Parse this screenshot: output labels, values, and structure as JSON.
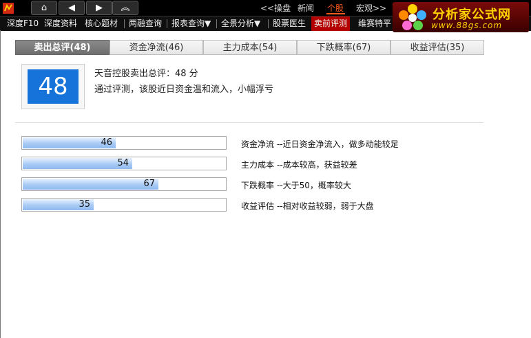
{
  "toolbar": {
    "nav_buttons": [
      {
        "name": "home-icon",
        "glyph": "⌂"
      },
      {
        "name": "back-icon",
        "glyph": "◀"
      },
      {
        "name": "forward-icon",
        "glyph": "▶"
      },
      {
        "name": "collapse-up-icon",
        "glyph": "︽"
      }
    ],
    "main_tabs": [
      "<<操盘",
      "新闻",
      "个股",
      "宏观>>"
    ],
    "active_main_tab": "个股"
  },
  "subnav": {
    "items": [
      "深度F10",
      "深度资料",
      "核心题材",
      "两融查询",
      "报表查询▼",
      "全景分析▼",
      "股票医生",
      "卖前评测",
      "维赛特平"
    ],
    "active": "卖前评测"
  },
  "watermark": {
    "name": "分析家公式网",
    "url": "www.88gs.com"
  },
  "tabs": [
    {
      "label": "卖出总评(48)",
      "active": true
    },
    {
      "label": "资金净流(46)",
      "active": false
    },
    {
      "label": "主力成本(54)",
      "active": false
    },
    {
      "label": "下跌概率(67)",
      "active": false
    },
    {
      "label": "收益评估(35)",
      "active": false
    }
  ],
  "summary": {
    "score": "48",
    "title": "天音控股卖出总评：48 分",
    "desc": "通过评测，该股近日资金温和流入，小幅浮亏"
  },
  "metrics": [
    {
      "label": "资金净流",
      "value": 46,
      "value_text": "46",
      "desc": "--近日资金净流入，做多动能较足"
    },
    {
      "label": "主力成本",
      "value": 54,
      "value_text": "54",
      "desc": "--成本较高，获益较差"
    },
    {
      "label": "下跌概率",
      "value": 67,
      "value_text": "67",
      "desc": "--大于50，概率较大"
    },
    {
      "label": "收益评估",
      "value": 35,
      "value_text": "35",
      "desc": "--相对收益较弱，弱于大盘"
    }
  ],
  "colors": {
    "accent": "#ff5a1a",
    "active_subnav": "#b40000",
    "score_tile": "#1573d9",
    "bar_fill": "#a9cbf5"
  }
}
